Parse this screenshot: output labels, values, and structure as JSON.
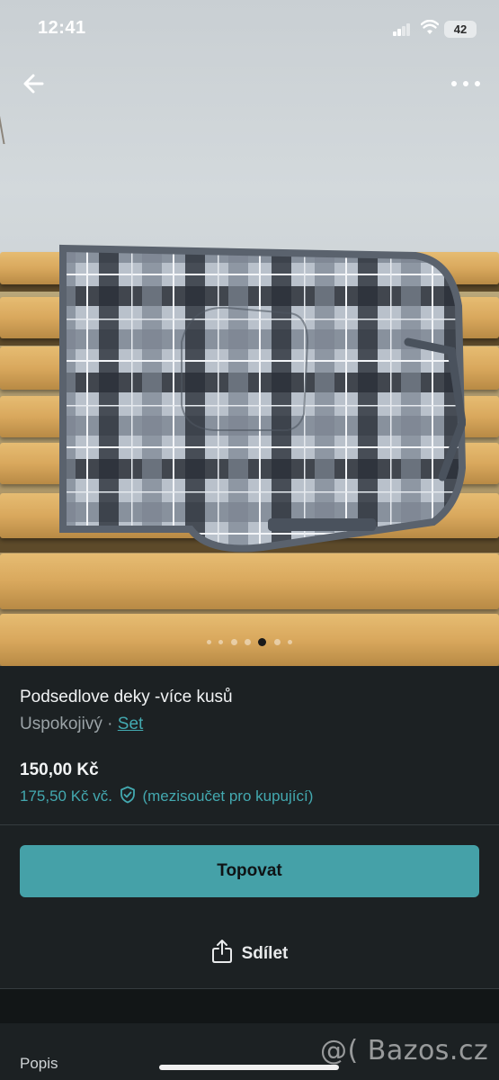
{
  "status_bar": {
    "time": "12:41",
    "battery": "42"
  },
  "gallery": {
    "dot_count": 7,
    "active_index": 4
  },
  "item": {
    "title": "Podsedlove deky -více kusů",
    "condition": "Uspokojivý",
    "separator": " · ",
    "category": "Set",
    "price": "150,00 Kč",
    "buyer_price": "175,50 Kč vč.",
    "buyer_note": "(mezisoučet pro kupující)"
  },
  "actions": {
    "bump_label": "Topovat",
    "share_label": "Sdílet"
  },
  "section": {
    "description_label": "Popis"
  },
  "watermark": "@( Bazos.cz",
  "colors": {
    "accent": "#45a1a8",
    "link": "#43a9b0",
    "background": "#1c2123"
  },
  "icons": [
    "back-arrow-icon",
    "more-icon",
    "shield-check-icon",
    "share-icon",
    "wifi-icon",
    "signal-icon"
  ]
}
